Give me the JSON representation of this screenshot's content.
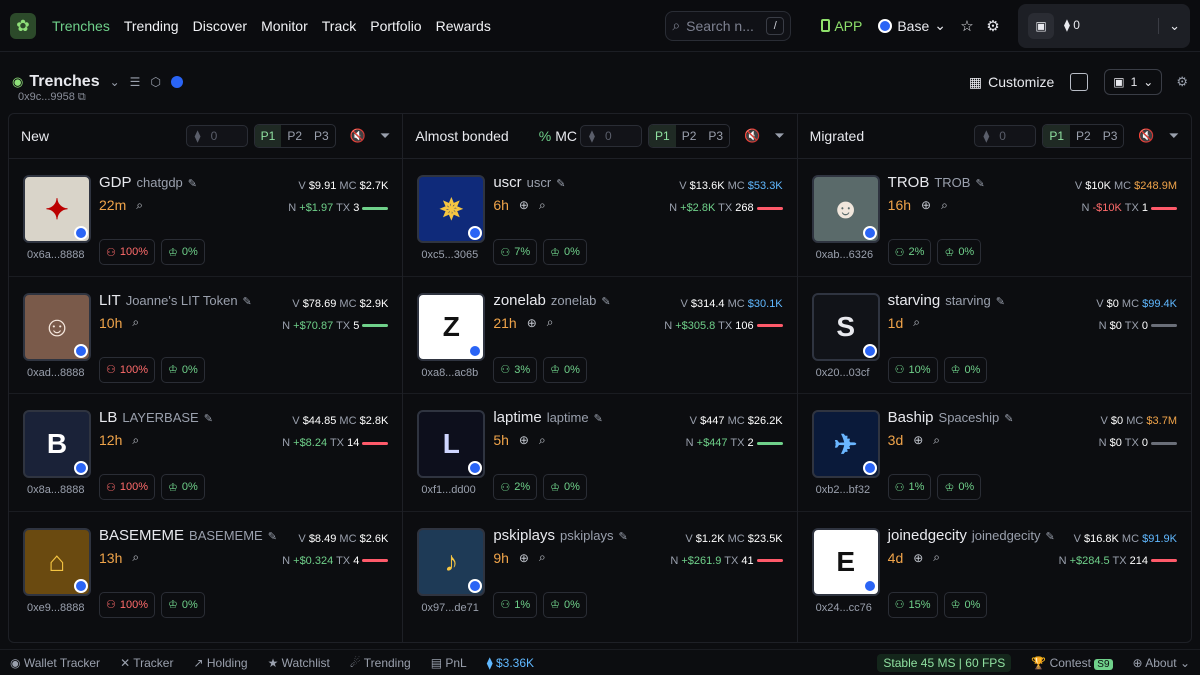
{
  "nav": {
    "items": [
      {
        "label": "Trenches",
        "active": true
      },
      {
        "label": "Trending"
      },
      {
        "label": "Discover"
      },
      {
        "label": "Monitor"
      },
      {
        "label": "Track"
      },
      {
        "label": "Portfolio"
      },
      {
        "label": "Rewards"
      }
    ]
  },
  "search": {
    "placeholder": "Search n...",
    "kbd": "/"
  },
  "app_label": "APP",
  "chain": "Base",
  "wallet": {
    "balance": "0",
    "address": "0x9c...9958"
  },
  "page": {
    "title": "Trenches",
    "customize": "Customize",
    "layout_count": "1"
  },
  "columns": [
    {
      "name": "New",
      "has_mc": false,
      "cards": [
        {
          "name": "GDP",
          "ticker": "chatgdp",
          "age": "22m",
          "globe": false,
          "V": "$9.91",
          "MC": "$2.7K",
          "mc_color": "white",
          "N": "+$1.97",
          "n_sign": "pos",
          "TX": "3",
          "bar": "green",
          "addr": "0x6a...8888",
          "b1": "100%",
          "b1c": "r",
          "b2": "0%",
          "img": "#d9d4c9",
          "img_fg": "#b00",
          "img_txt": "✦"
        },
        {
          "name": "LIT",
          "ticker": "Joanne's LIT Token",
          "age": "10h",
          "globe": false,
          "V": "$78.69",
          "MC": "$2.9K",
          "mc_color": "white",
          "N": "+$70.87",
          "n_sign": "pos",
          "TX": "5",
          "bar": "green",
          "addr": "0xad...8888",
          "b1": "100%",
          "b1c": "r",
          "b2": "0%",
          "img": "#7a5a4a",
          "img_fg": "#f4e6dc",
          "img_txt": "☺"
        },
        {
          "name": "LB",
          "ticker": "LAYERBASE",
          "age": "12h",
          "globe": false,
          "V": "$44.85",
          "MC": "$2.8K",
          "mc_color": "white",
          "N": "+$8.24",
          "n_sign": "pos",
          "TX": "14",
          "bar": "red",
          "addr": "0x8a...8888",
          "b1": "100%",
          "b1c": "r",
          "b2": "0%",
          "img": "#1a2238",
          "img_fg": "#ffffff",
          "img_txt": "B"
        },
        {
          "name": "BASEMEME",
          "ticker": "BASEMEME",
          "age": "13h",
          "globe": false,
          "V": "$8.49",
          "MC": "$2.6K",
          "mc_color": "white",
          "N": "+$0.324",
          "n_sign": "pos",
          "TX": "4",
          "bar": "red",
          "addr": "0xe9...8888",
          "b1": "100%",
          "b1c": "r",
          "b2": "0%",
          "img": "#6a4a10",
          "img_fg": "#f5c542",
          "img_txt": "⌂"
        }
      ]
    },
    {
      "name": "Almost bonded",
      "has_mc": true,
      "pct": "%",
      "mc_label": "MC",
      "cards": [
        {
          "name": "uscr",
          "ticker": "uscr",
          "age": "6h",
          "globe": true,
          "V": "$13.6K",
          "MC": "$53.3K",
          "mc_color": "blue",
          "N": "+$2.8K",
          "n_sign": "pos",
          "TX": "268",
          "bar": "red",
          "addr": "0xc5...3065",
          "b1": "7%",
          "b1c": "gr",
          "b2": "0%",
          "img": "#0f2a7a",
          "img_fg": "#f5c542",
          "img_txt": "✵",
          "tag": "2"
        },
        {
          "name": "zonelab",
          "ticker": "zonelab",
          "age": "21h",
          "globe": true,
          "V": "$314.4",
          "MC": "$30.1K",
          "mc_color": "blue",
          "N": "+$305.8",
          "n_sign": "pos",
          "TX": "106",
          "bar": "red",
          "addr": "0xa8...ac8b",
          "b1": "3%",
          "b1c": "gr",
          "b2": "0%",
          "img": "#ffffff",
          "img_fg": "#111",
          "img_txt": "Z"
        },
        {
          "name": "laptime",
          "ticker": "laptime",
          "age": "5h",
          "globe": true,
          "V": "$447",
          "MC": "$26.2K",
          "mc_color": "white",
          "N": "+$447",
          "n_sign": "pos",
          "TX": "2",
          "bar": "green",
          "addr": "0xf1...dd00",
          "b1": "2%",
          "b1c": "gr",
          "b2": "0%",
          "img": "#0d0f1c",
          "img_fg": "#cfd6ff",
          "img_txt": "L"
        },
        {
          "name": "pskiplays",
          "ticker": "pskiplays",
          "age": "9h",
          "globe": true,
          "V": "$1.2K",
          "MC": "$23.5K",
          "mc_color": "white",
          "N": "+$261.9",
          "n_sign": "pos",
          "TX": "41",
          "bar": "red",
          "addr": "0x97...de71",
          "b1": "1%",
          "b1c": "gr",
          "b2": "0%",
          "img": "#1e3a56",
          "img_fg": "#f5c542",
          "img_txt": "♪"
        }
      ]
    },
    {
      "name": "Migrated",
      "has_mc": false,
      "cards": [
        {
          "name": "TROB",
          "ticker": "TROB",
          "age": "16h",
          "globe": true,
          "V": "$10K",
          "MC": "$248.9M",
          "mc_color": "orange",
          "N": "-$10K",
          "n_sign": "neg",
          "TX": "1",
          "bar": "red",
          "addr": "0xab...6326",
          "b1": "2%",
          "b1c": "gr",
          "b2": "0%",
          "img": "#5a6a6a",
          "img_fg": "#f0e6dc",
          "img_txt": "☻"
        },
        {
          "name": "starving",
          "ticker": "starving",
          "age": "1d",
          "globe": false,
          "V": "$0",
          "MC": "$99.4K",
          "mc_color": "blue",
          "N": "$0",
          "n_sign": "none",
          "TX": "0",
          "bar": "grey",
          "addr": "0x20...03cf",
          "b1": "10%",
          "b1c": "gr",
          "b2": "0%",
          "img": "#111318",
          "img_fg": "#e8e9ee",
          "img_txt": "S"
        },
        {
          "name": "Baship",
          "ticker": "Spaceship",
          "age": "3d",
          "globe": true,
          "V": "$0",
          "MC": "$3.7M",
          "mc_color": "orange",
          "N": "$0",
          "n_sign": "none",
          "TX": "0",
          "bar": "grey",
          "addr": "0xb2...bf32",
          "b1": "1%",
          "b1c": "gr",
          "b2": "0%",
          "img": "#0a1a3a",
          "img_fg": "#6ab6ff",
          "img_txt": "✈"
        },
        {
          "name": "joinedgecity",
          "ticker": "joinedgecity",
          "age": "4d",
          "globe": true,
          "V": "$16.8K",
          "MC": "$91.9K",
          "mc_color": "blue",
          "N": "+$284.5",
          "n_sign": "pos",
          "TX": "214",
          "bar": "red",
          "addr": "0x24...cc76",
          "b1": "15%",
          "b1c": "gr",
          "b2": "0%",
          "img": "#ffffff",
          "img_fg": "#111",
          "img_txt": "E"
        }
      ]
    }
  ],
  "footer": {
    "items": [
      "Wallet Tracker",
      "Tracker",
      "Holding",
      "Watchlist",
      "Trending",
      "PnL"
    ],
    "eth_price": "$3.36K",
    "stable": "Stable 45 MS",
    "fps": "60 FPS",
    "contest": "Contest",
    "season": "S9",
    "about": "About"
  }
}
